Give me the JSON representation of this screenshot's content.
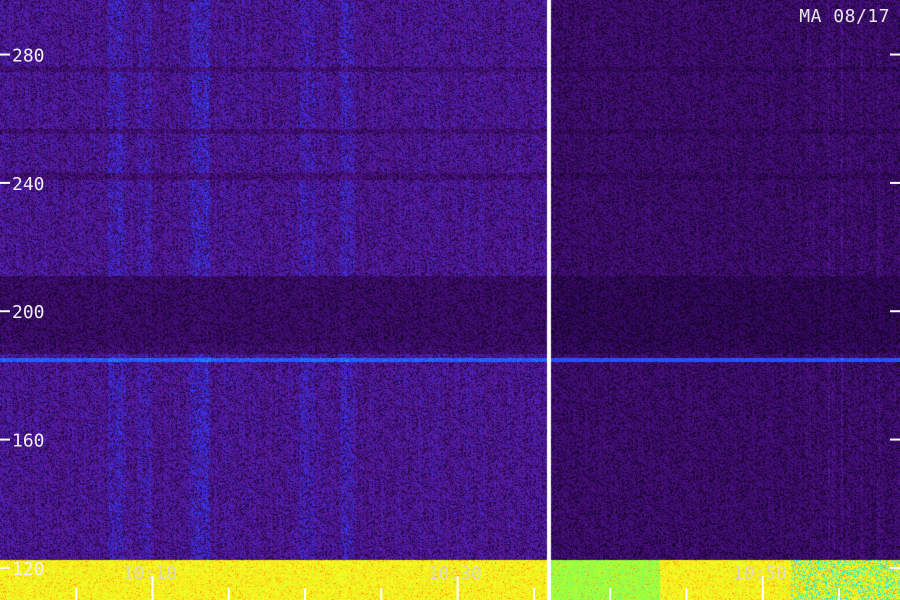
{
  "chart_data": {
    "type": "heatmap",
    "title": "MA 08/17",
    "xlabel": "",
    "ylabel": "",
    "y_ticks": [
      "120",
      "160",
      "200",
      "240",
      "280"
    ],
    "y_tick_values": [
      120,
      160,
      200,
      240,
      280
    ],
    "x_ticks": [
      "10:10",
      "10:30",
      "10:50"
    ],
    "x_tick_values": [
      10.1667,
      10.5,
      10.8333
    ],
    "xlim": [
      10.0,
      10.9833
    ],
    "ylim": [
      110,
      297
    ],
    "data_gap_time": 10.6,
    "bands": {
      "strong_line_freq": 185,
      "low_freq_floor": 120,
      "quiet_band": [
        190,
        211
      ]
    },
    "colormap": [
      "#000000",
      "#3a0a6b",
      "#5b1a9e",
      "#2b38ff",
      "#19a0ff",
      "#30f0c0",
      "#a8ff30",
      "#ffff20",
      "#ff9a10",
      "#ff2000"
    ],
    "grid": false
  }
}
